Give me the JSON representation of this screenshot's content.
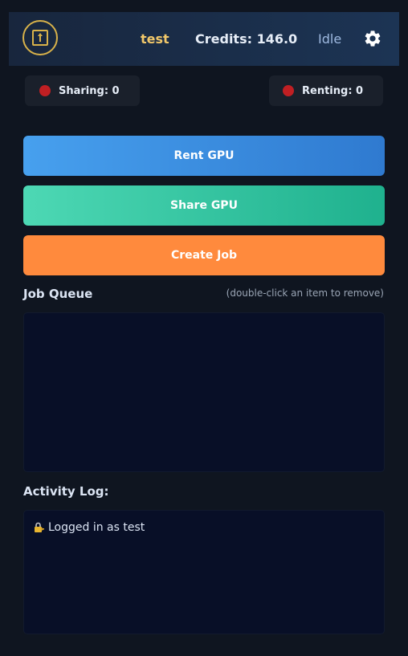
{
  "header": {
    "username": "test",
    "credits_label": "Credits: 146.0",
    "status": "Idle",
    "icons": {
      "logo": "gpu-chip-icon",
      "settings": "gear-icon"
    }
  },
  "stats": {
    "sharing_label": "Sharing: 0",
    "renting_label": "Renting: 0",
    "indicator_color": "#c01f23"
  },
  "actions": {
    "rent_label": "Rent GPU",
    "share_label": "Share GPU",
    "create_job_label": "Create Job"
  },
  "job_queue": {
    "title": "Job Queue",
    "hint": "(double-click an item to remove)",
    "items": []
  },
  "activity_log": {
    "title": "Activity Log:",
    "entries": [
      {
        "icon": "lock-key-icon",
        "text": "Logged in as test"
      }
    ]
  },
  "colors": {
    "accent_gold": "#f2c86a",
    "rent_blue": "#3b8ce0",
    "share_green": "#2fc39e",
    "job_orange": "#ff8a3d"
  }
}
